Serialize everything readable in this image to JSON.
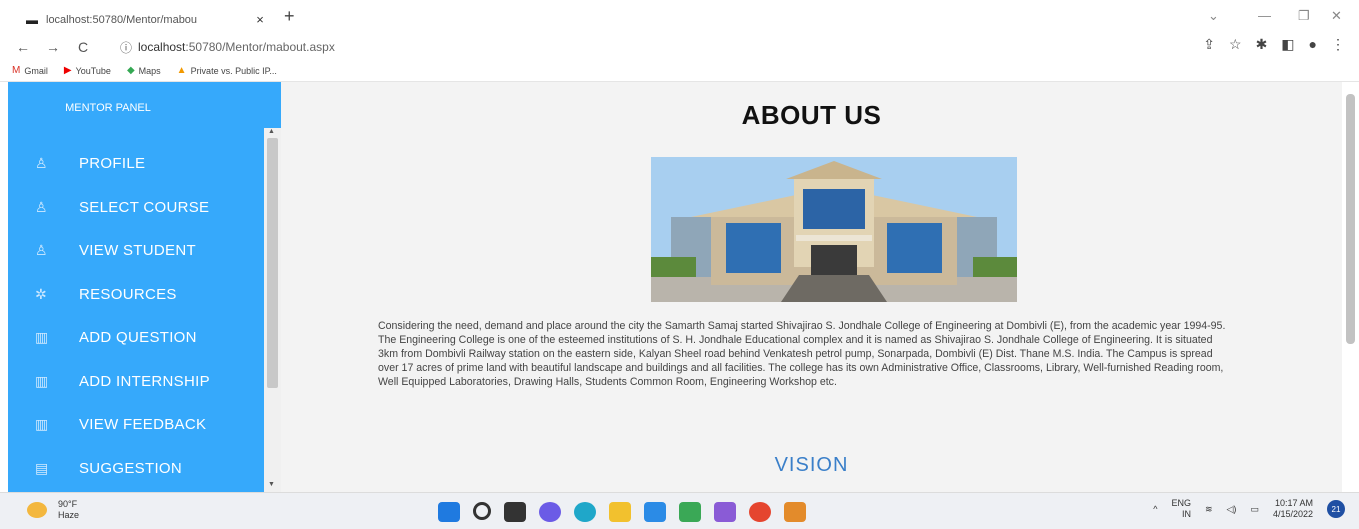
{
  "browser": {
    "tab_title": "localhost:50780/Mentor/mabou",
    "tab_close": "×",
    "new_tab": "+",
    "url_host": "localhost",
    "url_path": ":50780/Mentor/mabout.aspx",
    "bookmarks": [
      {
        "label": "Gmail",
        "icon": "gmail-icon"
      },
      {
        "label": "YouTube",
        "icon": "youtube-icon"
      },
      {
        "label": "Maps",
        "icon": "maps-icon"
      },
      {
        "label": "Private vs. Public IP...",
        "icon": "bookmark-icon"
      }
    ]
  },
  "sidebar": {
    "header": "MENTOR PANEL",
    "items": [
      {
        "label": "PROFILE",
        "icon": "user-icon"
      },
      {
        "label": "SELECT COURSE",
        "icon": "user-icon"
      },
      {
        "label": "VIEW STUDENT",
        "icon": "user-icon"
      },
      {
        "label": "RESOURCES",
        "icon": "gear-icon"
      },
      {
        "label": "ADD QUESTION",
        "icon": "map-icon"
      },
      {
        "label": "ADD INTERNSHIP",
        "icon": "map-icon"
      },
      {
        "label": "VIEW FEEDBACK",
        "icon": "map-icon"
      },
      {
        "label": "SUGGESTION",
        "icon": "document-icon"
      }
    ]
  },
  "main": {
    "title": "ABOUT US",
    "paragraph": "Considering the need, demand and place around the city the Samarth Samaj started Shivajirao S. Jondhale College of Engineering at Dombivli (E), from the academic year 1994-95. The Engineering College is one of the esteemed institutions of S. H. Jondhale Educational complex and it is named as Shivajirao S. Jondhale College of Engineering. It is situated 3km from Dombivli Railway station on the eastern side, Kalyan Sheel road behind Venkatesh petrol pump, Sonarpada, Dombivli (E) Dist. Thane M.S. India. The Campus is spread over 17 acres of prime land with beautiful landscape and buildings and all facilities. The college has its own Administrative Office, Classrooms, Library, Well-furnished Reading room, Well Equipped Laboratories, Drawing Halls, Students Common Room, Engineering Workshop etc.",
    "vision_heading": "VISION"
  },
  "taskbar": {
    "weather_temp": "90°F",
    "weather_desc": "Haze",
    "lang_top": "ENG",
    "lang_bottom": "IN",
    "time": "10:17 AM",
    "date": "4/15/2022",
    "notification_count": "21"
  }
}
